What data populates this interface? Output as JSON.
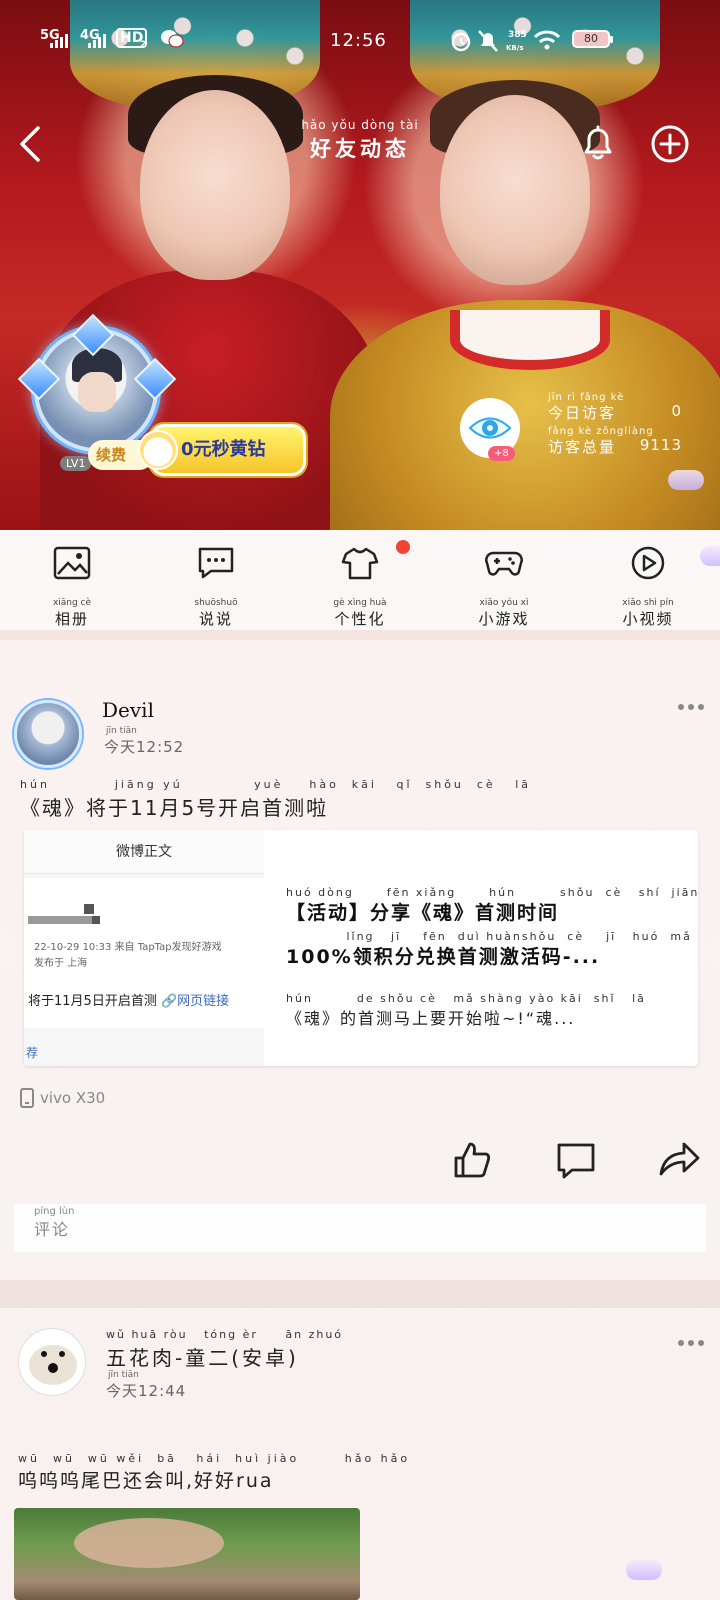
{
  "status_bar": {
    "network1": "5G",
    "network2": "4G",
    "hd": "HD",
    "hd_sub": "2",
    "time": "12:56",
    "net_speed": "385",
    "net_unit": "KB/s",
    "battery": "80"
  },
  "nav": {
    "title_pinyin": "hǎo yǒu dòng tài",
    "title": "好友动态"
  },
  "profile": {
    "level": "LV1",
    "renew": "续费",
    "vip_promo": "0元秒黄钻",
    "visitor_badge": "+8",
    "today_visitors_pinyin": "jīn  rì  fǎng  kè",
    "today_visitors_label": "今日访客",
    "today_visitors": "0",
    "total_visitors_pinyin": "fǎng  kè  zǒngliàng",
    "total_visitors_label": "访客总量",
    "total_visitors": "9113"
  },
  "quick_menu": [
    {
      "pinyin": "xiāng  cè",
      "label": "相册",
      "icon": "photo-album-icon"
    },
    {
      "pinyin": "shuōshuō",
      "label": "说说",
      "icon": "chat-bubble-icon"
    },
    {
      "pinyin": "gè  xìng huà",
      "label": "个性化",
      "icon": "tshirt-icon"
    },
    {
      "pinyin": "xiǎo yóu  xì",
      "label": "小游戏",
      "icon": "gamepad-icon"
    },
    {
      "pinyin": "xiǎo shì  pín",
      "label": "小视频",
      "icon": "play-circle-icon"
    }
  ],
  "posts": [
    {
      "author": "Devil",
      "time_pinyin": "jīn  tiān",
      "time": "今天12:52",
      "content_pinyin": "hún          jiāng yú           yuè    hào  kāi   qǐ  shǒu  cè   lā",
      "content": "《魂》将于11月5号开启首测啦",
      "share": {
        "thumb_header": "微博正文",
        "thumb_meta_time": "22-10-29 10:33  来自 TapTap发现好游戏",
        "thumb_meta_place": "发布于 上海",
        "thumb_text": "将于11月5日开启首测",
        "thumb_link": "网页链接",
        "thumb_more": "荐",
        "line1_pinyin": "huó dòng      fēn xiǎng      hún        shǒu  cè   shí  jiān",
        "line1": "【活动】分享《魂》首测时间",
        "line2_pinyin": "           lǐng   jī    fēn  duì huànshǒu  cè    jī   huó  mǎ",
        "line2": "100%领积分兑换首测激活码-...",
        "line3_pinyin": "hún        de shǒu cè   mǎ shàng yào kāi  shǐ   lā          hún",
        "line3": "《魂》的首测马上要开始啦~!“魂..."
      },
      "device": "vivo X30",
      "comment_pinyin": "píng lùn",
      "comment_placeholder": "评论"
    },
    {
      "author_pinyin": "wǔ huā ròu   tóng èr     ān zhuó",
      "author": "五花肉-童二(安卓)",
      "time_pinyin": "jīn tiān",
      "time": "今天12:44",
      "content_pinyin": "wū  wū  wū wěi  bā   hái  huì jiào       hǎo hǎo",
      "content": "呜呜呜尾巴还会叫,好好rua"
    }
  ]
}
